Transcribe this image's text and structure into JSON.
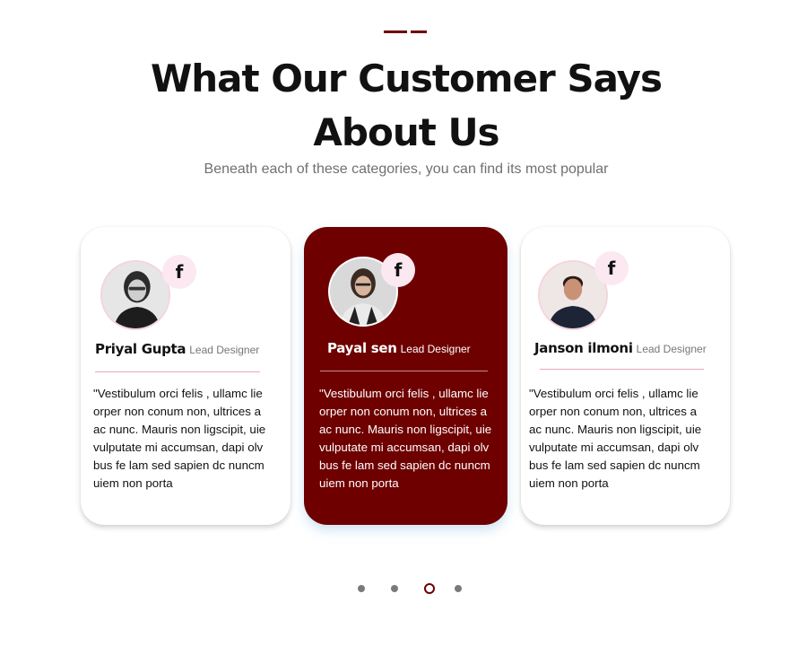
{
  "header": {
    "title_line1": "What Our Customer Says",
    "title_line2": "About Us",
    "subtitle": "Beneath each of these categories, you can find its most popular"
  },
  "colors": {
    "accent": "#6e0000",
    "facebook_badge_bg": "#fbe8f0",
    "divider": "#e9a7b4",
    "text_dark": "#111111",
    "text_muted": "#707070"
  },
  "testimonials": [
    {
      "name": "Priyal Gupta",
      "role": "Lead Designer",
      "social_icon": "facebook-icon",
      "social_glyph": "f",
      "quote": "\"Vestibulum orci felis , ullamc lie orper non conum non, ultrices a ac nunc. Mauris non ligscipit, uie vulputate mi accumsan, dapi olv bus fe lam sed sapien dc nuncm uiem non porta",
      "active": false
    },
    {
      "name": "Payal sen",
      "role": "Lead Designer",
      "social_icon": "facebook-icon",
      "social_glyph": "f",
      "quote": "\"Vestibulum orci felis , ullamc lie orper non conum non, ultrices a ac nunc. Mauris non ligscipit, uie vulputate mi accumsan, dapi olv bus fe lam sed sapien dc nuncm uiem non porta",
      "active": true
    },
    {
      "name": "Janson ilmoni",
      "role": "Lead Designer",
      "social_icon": "facebook-icon",
      "social_glyph": "f",
      "quote": "\"Vestibulum orci felis , ullamc lie orper non conum non, ultrices a ac nunc. Mauris non ligscipit, uie vulputate mi accumsan, dapi olv bus fe lam sed sapien dc nuncm uiem non porta",
      "active": false
    }
  ],
  "pagination": {
    "total": 4,
    "active_index": 2
  }
}
